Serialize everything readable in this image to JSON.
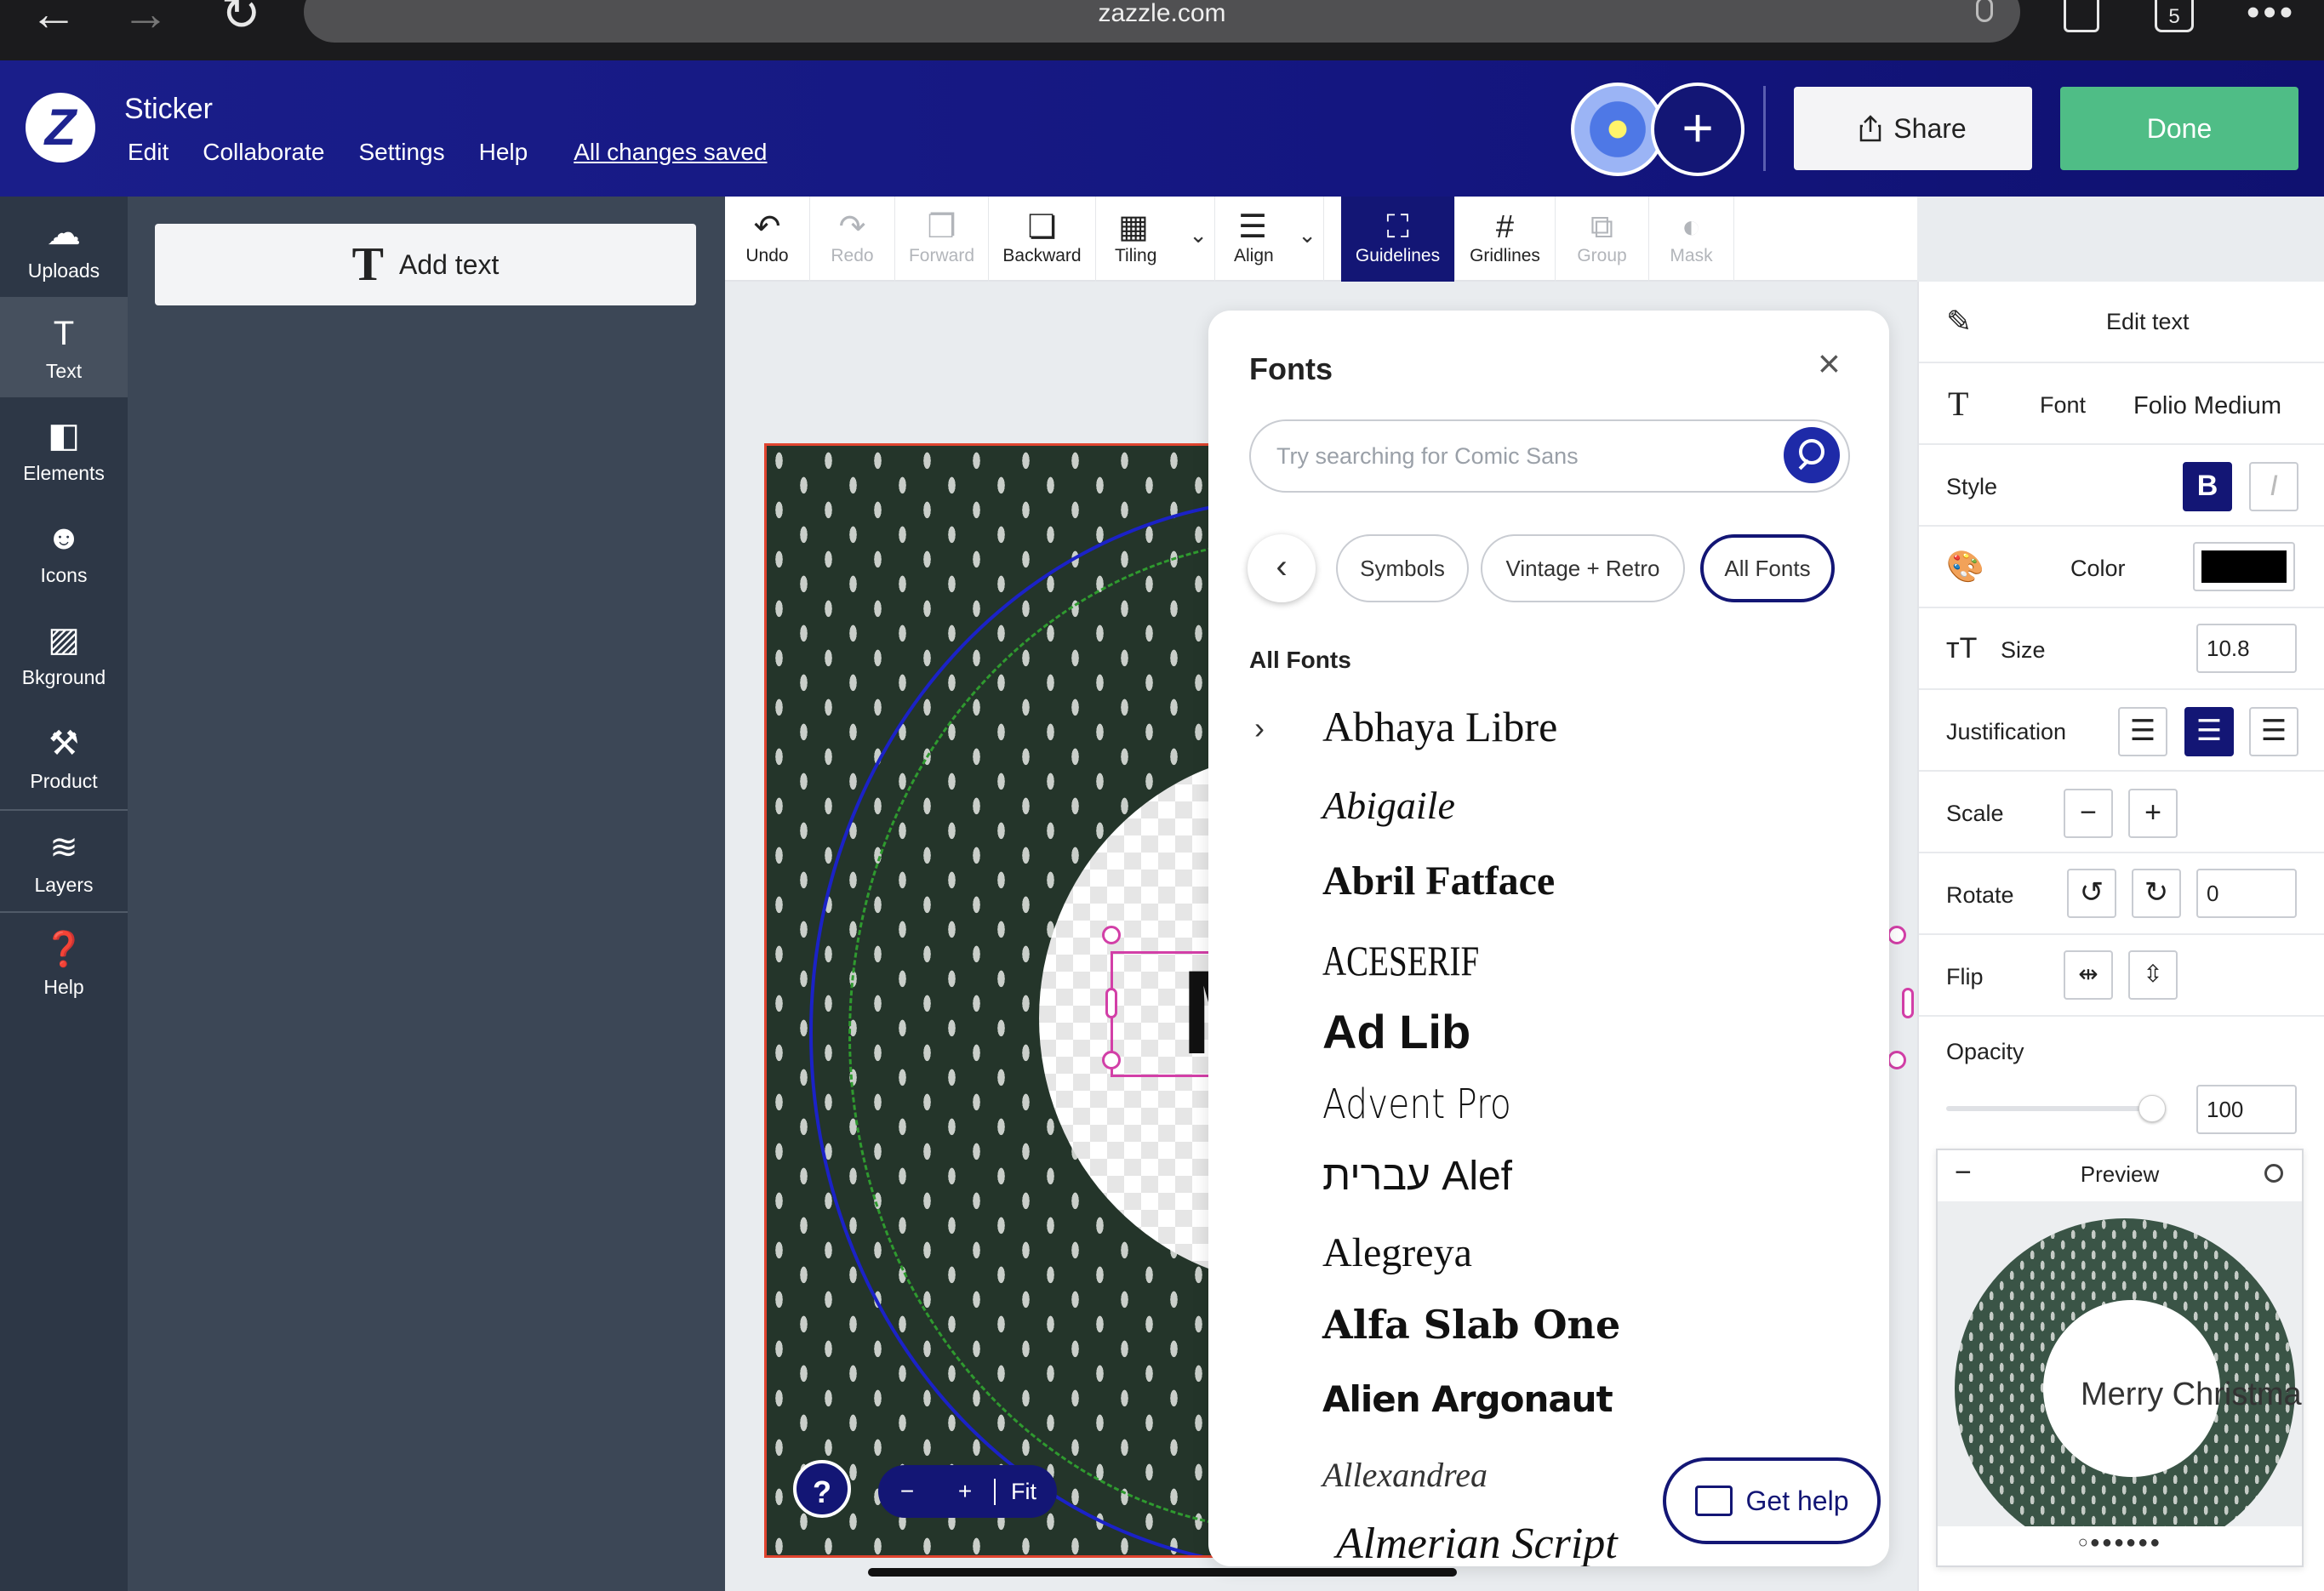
{
  "browser": {
    "url": "zazzle.com",
    "tab_count": "5",
    "back_icon": "arrow-left-icon",
    "forward_icon": "arrow-right-icon",
    "reload_icon": "reload-icon"
  },
  "header": {
    "logo_letter": "Z",
    "doc_title": "Sticker",
    "menu": [
      "Edit",
      "Collaborate",
      "Settings",
      "Help"
    ],
    "saved_status": "All changes saved",
    "share_label": "Share",
    "done_label": "Done",
    "add_collab": "+"
  },
  "rail": {
    "items": [
      {
        "label": "Uploads",
        "icon": "cloud-upload-icon"
      },
      {
        "label": "Text",
        "icon": "text-icon"
      },
      {
        "label": "Elements",
        "icon": "elements-icon"
      },
      {
        "label": "Icons",
        "icon": "smiley-icon"
      },
      {
        "label": "Bkground",
        "icon": "background-icon"
      },
      {
        "label": "Product",
        "icon": "product-icon"
      },
      {
        "label": "Layers",
        "icon": "layers-icon"
      },
      {
        "label": "Help",
        "icon": "help-icon"
      }
    ]
  },
  "text_panel": {
    "add_text_label": "Add text",
    "add_text_icon": "T"
  },
  "toolbar": {
    "tools": [
      {
        "label": "Undo",
        "glyph": "↶",
        "disabled": false
      },
      {
        "label": "Redo",
        "glyph": "↷",
        "disabled": true
      },
      {
        "label": "Forward",
        "glyph": "❐",
        "disabled": true
      },
      {
        "label": "Backward",
        "glyph": "❏",
        "disabled": false
      },
      {
        "label": "Tiling",
        "glyph": "▦",
        "disabled": false
      },
      {
        "label": "Align",
        "glyph": "☰",
        "disabled": false
      },
      {
        "label": "Guidelines",
        "glyph": "⛶",
        "disabled": false
      },
      {
        "label": "Gridlines",
        "glyph": "#",
        "disabled": false
      },
      {
        "label": "Group",
        "glyph": "⧉",
        "disabled": true
      },
      {
        "label": "Mask",
        "glyph": "◐",
        "disabled": true
      }
    ]
  },
  "canvas": {
    "selected_text_visible": "M",
    "zoom_out": "−",
    "zoom_in": "+",
    "fit": "Fit",
    "help": "?"
  },
  "fonts_popup": {
    "title": "Fonts",
    "search_placeholder": "Try searching for Comic Sans",
    "chips": [
      "Symbols",
      "Vintage + Retro",
      "All Fonts"
    ],
    "selected_chip": "All Fonts",
    "section": "All Fonts",
    "fonts": [
      "Abhaya Libre",
      "Abigaile",
      "Abril Fatface",
      "ACESERIF",
      "Ad Lib",
      "Advent Pro",
      "עברית Alef",
      "Alegreya",
      "Alfa Slab One",
      "Alien Argonaut",
      "Allexandrea",
      "Almerian Script"
    ]
  },
  "get_help": {
    "label": "Get help"
  },
  "props": {
    "title": "Edit text",
    "font_label": "Font",
    "font_value": "Folio Medium",
    "style_label": "Style",
    "bold": "B",
    "italic": "I",
    "color_label": "Color",
    "color_value": "#000000",
    "size_label": "Size",
    "size_value": "10.8",
    "justification_label": "Justification",
    "scale_label": "Scale",
    "scale_minus": "−",
    "scale_plus": "+",
    "rotate_label": "Rotate",
    "rotate_value": "0",
    "flip_label": "Flip",
    "opacity_label": "Opacity",
    "opacity_value": "100",
    "opacity_fraction": 1.0
  },
  "preview": {
    "title": "Preview",
    "minus": "−",
    "text": "Merry Christmas",
    "dots": "○●●●●●●"
  },
  "colors": {
    "brand": "#131675",
    "done": "#4fbd86",
    "selection": "#d23fa7",
    "bleed": "#1b22c7",
    "safe": "#2f9a2f"
  }
}
